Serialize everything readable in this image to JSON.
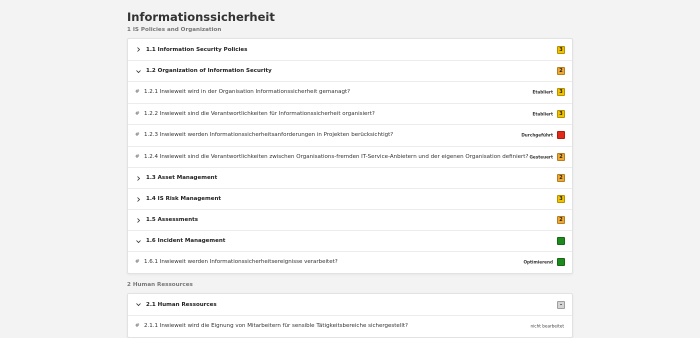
{
  "title": "Informationssicherheit",
  "colors": {
    "yellow": "#f2c200",
    "orange": "#f0a830",
    "red": "#e22a1a",
    "green": "#1e8a1e",
    "gray": "#d4d4d4"
  },
  "sections": [
    {
      "title": "1 IS Policies and Organization"
    },
    {
      "title": "2 Human Ressources"
    }
  ],
  "s1": {
    "r1": {
      "label": "1.1 Information Security Policies",
      "badge": "3",
      "icon": "chevron-right-icon"
    },
    "r2": {
      "label": "1.2 Organization of Information Security",
      "badge": "2",
      "icon": "chevron-down-icon"
    },
    "q1": {
      "label": "1.2.1 Inwieweit wird in der Organisation Informationssicherheit gemanagt?",
      "status": "Etabliert",
      "badge": "3"
    },
    "q2": {
      "label": "1.2.2 Inwieweit sind die Verantwortlichkeiten für Informationssicherheit organisiert?",
      "status": "Etabliert",
      "badge": "3"
    },
    "q3": {
      "label": "1.2.3 Inwieweit werden Informationssicherheitsanforderungen in Projekten berücksichtigt?",
      "status": "Durchgeführt",
      "badge": "1"
    },
    "q4": {
      "label": "1.2.4 Inwieweit sind die Verantwortlichkeiten zwischen Organisations-fremden IT-Service-Anbietern und der eigenen Organisation definiert?",
      "status": "Gesteuert",
      "badge": "2"
    },
    "r3": {
      "label": "1.3 Asset Management",
      "badge": "2",
      "icon": "chevron-right-icon"
    },
    "r4": {
      "label": "1.4 IS Risk Management",
      "badge": "3",
      "icon": "chevron-right-icon"
    },
    "r5": {
      "label": "1.5 Assessments",
      "badge": "2",
      "icon": "chevron-right-icon"
    },
    "r6": {
      "label": "1.6 Incident Management",
      "badge": "5",
      "icon": "chevron-down-icon"
    },
    "q5": {
      "label": "1.6.1 Inwieweit werden Informationssicherheitsereignisse verarbeitet?",
      "status": "Optimierend",
      "badge": "5"
    }
  },
  "s2": {
    "r1": {
      "label": "2.1 Human Ressources",
      "badge": "-",
      "icon": "chevron-down-icon"
    },
    "q1": {
      "label": "2.1.1 Inwieweit wird die Eignung von Mitarbeitern für sensible Tätigkeitsbereiche sichergestellt?",
      "status": "nicht bearbeitet"
    }
  },
  "hash_symbol": "#"
}
